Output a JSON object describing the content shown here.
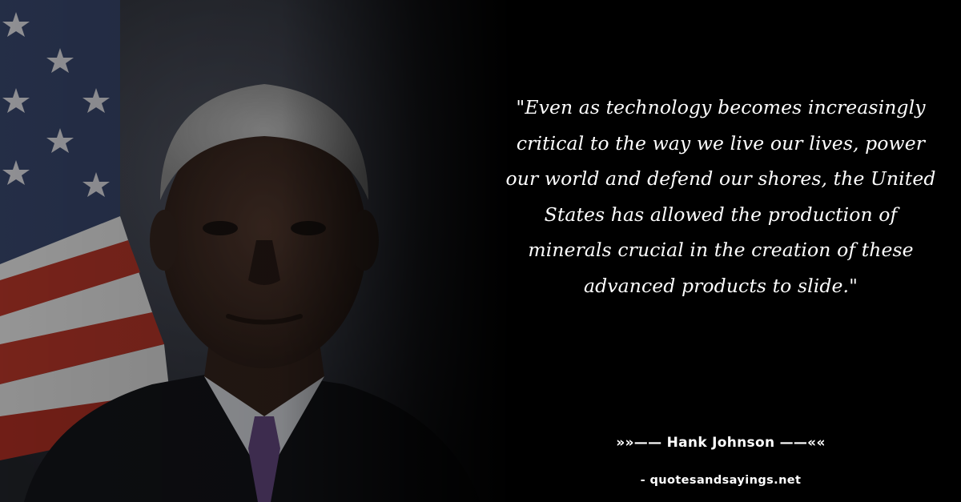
{
  "quote": {
    "text": "\"Even as technology becomes increasingly critical to the way we live our lives, power our world and defend our shores, the United States has allowed the production of minerals crucial in the creation of these advanced products to slide.\""
  },
  "author": {
    "line": "»»—— Hank Johnson ——««"
  },
  "site": {
    "credit": "- quotesandsayings.net"
  },
  "colors": {
    "background": "#000000",
    "text": "#ffffff"
  },
  "image": {
    "subject": "portrait-photo",
    "icon": "flag-icon"
  }
}
